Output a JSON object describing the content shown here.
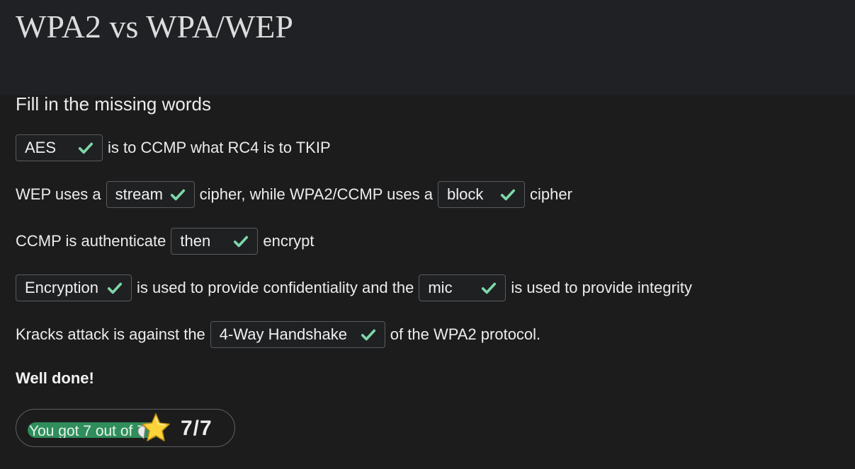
{
  "page": {
    "title": "WPA2 vs WPA/WEP"
  },
  "quiz": {
    "heading": "Fill in the missing words",
    "lines": [
      {
        "segments": [
          {
            "answer": "AES"
          },
          {
            "text": "is to CCMP what RC4 is to TKIP"
          }
        ]
      },
      {
        "segments": [
          {
            "text": "WEP uses a"
          },
          {
            "answer": "stream"
          },
          {
            "text": "cipher, while WPA2/CCMP uses a"
          },
          {
            "answer": "block"
          },
          {
            "text": "cipher"
          }
        ]
      },
      {
        "segments": [
          {
            "text": "CCMP is authenticate"
          },
          {
            "answer": "then"
          },
          {
            "text": "encrypt"
          }
        ]
      },
      {
        "segments": [
          {
            "answer": "Encryption"
          },
          {
            "text": "is used to provide confidentiality and the"
          },
          {
            "answer": "mic"
          },
          {
            "text": "is used to provide integrity"
          }
        ]
      },
      {
        "segments": [
          {
            "text": "Kracks attack is against the"
          },
          {
            "answer": "4-Way Handshake"
          },
          {
            "text": "of the WPA2 protocol."
          }
        ]
      }
    ],
    "feedback": "Well done!",
    "result": {
      "progress_text": "You got 7 out of 7",
      "score": "7/7",
      "correct": 7,
      "total": 7
    }
  },
  "colors": {
    "check": "#7ed7a9",
    "progress": "#2f8e5b",
    "star": "#ffd43b"
  },
  "icons": {
    "correct": "check-icon",
    "score": "star-icon"
  }
}
